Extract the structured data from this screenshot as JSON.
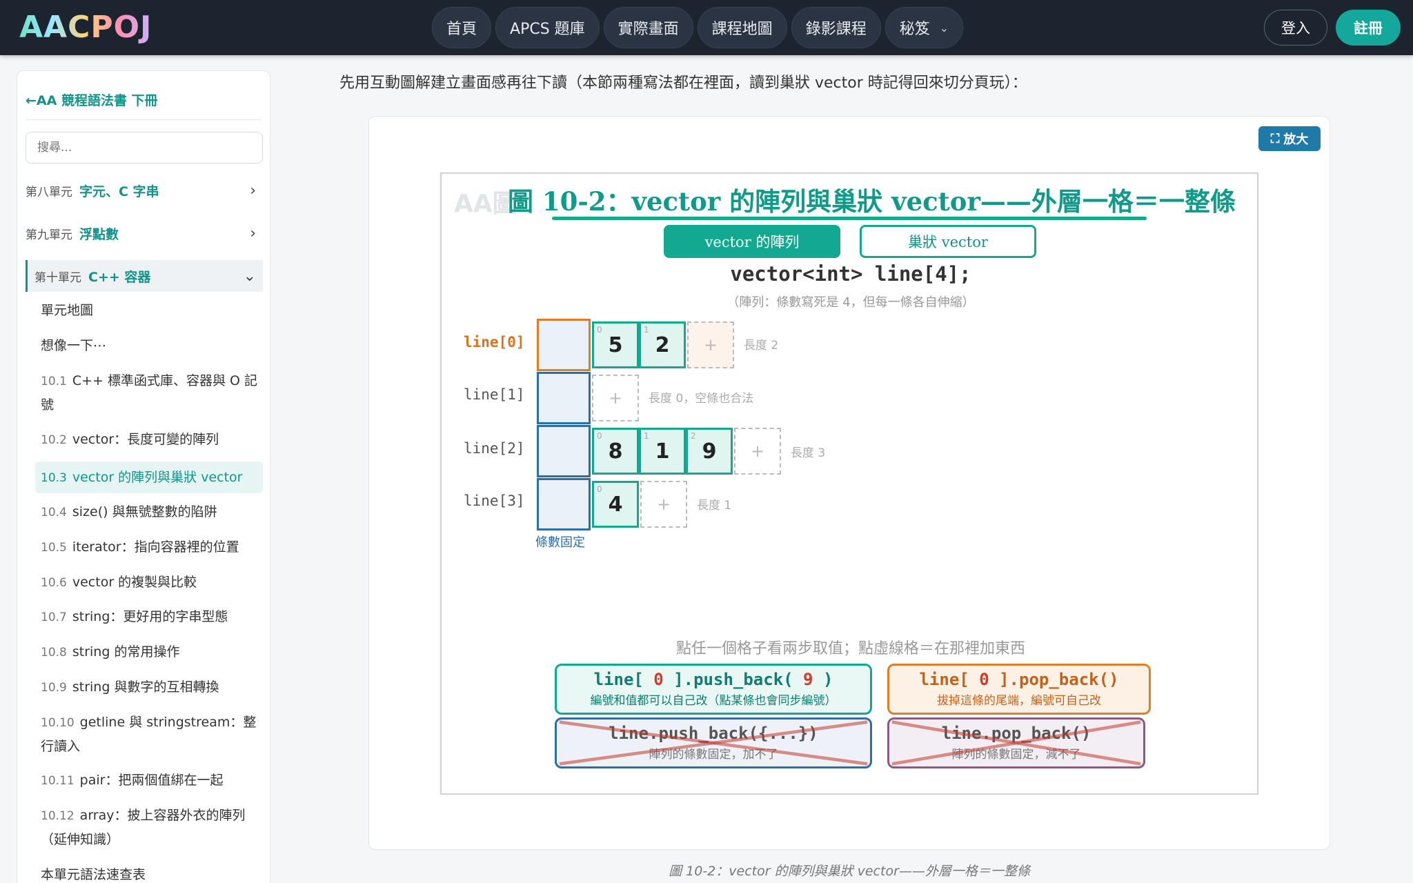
{
  "nav": {
    "logo": "AACPOJ",
    "items": [
      "首頁",
      "APCS 題庫",
      "實際畫面",
      "課程地圖",
      "錄影課程",
      "秘笈"
    ],
    "login": "登入",
    "register": "註冊"
  },
  "sidebar": {
    "back": "←AA 競程語法書 下冊",
    "search_placeholder": "搜尋...",
    "units": [
      {
        "prefix": "第八單元",
        "name": "字元、C 字串"
      },
      {
        "prefix": "第九單元",
        "name": "浮點數"
      },
      {
        "prefix": "第十單元",
        "name": "C++ 容器"
      }
    ],
    "lessons": [
      {
        "num": "",
        "title": "單元地圖"
      },
      {
        "num": "",
        "title": "想像一下⋯"
      },
      {
        "num": "10.1",
        "title": "C++ 標準函式庫、容器與 O 記號"
      },
      {
        "num": "10.2",
        "title": "vector：長度可變的陣列"
      },
      {
        "num": "10.3",
        "title": "vector 的陣列與巢狀 vector"
      },
      {
        "num": "10.4",
        "title": "size() 與無號整數的陷阱"
      },
      {
        "num": "10.5",
        "title": "iterator：指向容器裡的位置"
      },
      {
        "num": "10.6",
        "title": "vector 的複製與比較"
      },
      {
        "num": "10.7",
        "title": "string：更好用的字串型態"
      },
      {
        "num": "10.8",
        "title": "string 的常用操作"
      },
      {
        "num": "10.9",
        "title": "string 與數字的互相轉換"
      },
      {
        "num": "10.10",
        "title": "getline 與 stringstream：整行讀入"
      },
      {
        "num": "10.11",
        "title": "pair：把兩個值綁在一起"
      },
      {
        "num": "10.12",
        "title": "array：披上容器外衣的陣列（延伸知識）"
      },
      {
        "num": "",
        "title": "本單元語法速查表"
      }
    ]
  },
  "main": {
    "intro": "先用互動圖解建立畫面感再往下讀（本節兩種寫法都在裡面，讀到巢狀 vector 時記得回來切分頁玩）：",
    "zoom": "放大",
    "caption": "圖 10-2：vector 的陣列與巢狀 vector——外層一格＝一整條"
  },
  "figure": {
    "watermark": "AA圖",
    "title": "圖 10-2：vector 的陣列與巢狀 vector——外層一格＝一整條",
    "tabs": [
      "vector 的陣列",
      "巢狀 vector"
    ],
    "decl": "vector<int> line[4];",
    "decl_note": "（陣列：條數寫死是 4，但每一條各自伸縮）",
    "rows": [
      {
        "label": "line[0]",
        "values": [
          "5",
          "2"
        ],
        "len": "長度 2"
      },
      {
        "label": "line[1]",
        "values": [],
        "len": "長度 0，空條也合法"
      },
      {
        "label": "line[2]",
        "values": [
          "8",
          "1",
          "9"
        ],
        "len": "長度 3"
      },
      {
        "label": "line[3]",
        "values": [
          "4"
        ],
        "len": "長度 1"
      }
    ],
    "indices": [
      "0",
      "1",
      "2"
    ],
    "plus": "+",
    "fixed": "條數固定",
    "hint": "點任一個格子看兩步取值；點虛線格＝在那裡加東西",
    "ops": {
      "push_a": "line[ ",
      "push_b": "0",
      "push_c": " ].push_back( ",
      "push_d": "9",
      "push_e": " )",
      "push_sub": "編號和值都可以自己改（點某條也會同步編號）",
      "pop_a": "line[ ",
      "pop_b": "0",
      "pop_c": " ].pop_back()",
      "pop_sub": "拔掉這條的尾端，編號可自己改",
      "x1_code": "line.push_back({...})",
      "x1_sub": "陣列的條數固定，加不了",
      "x2_code": "line.pop_back()",
      "x2_sub": "陣列的條數固定，減不了"
    }
  }
}
